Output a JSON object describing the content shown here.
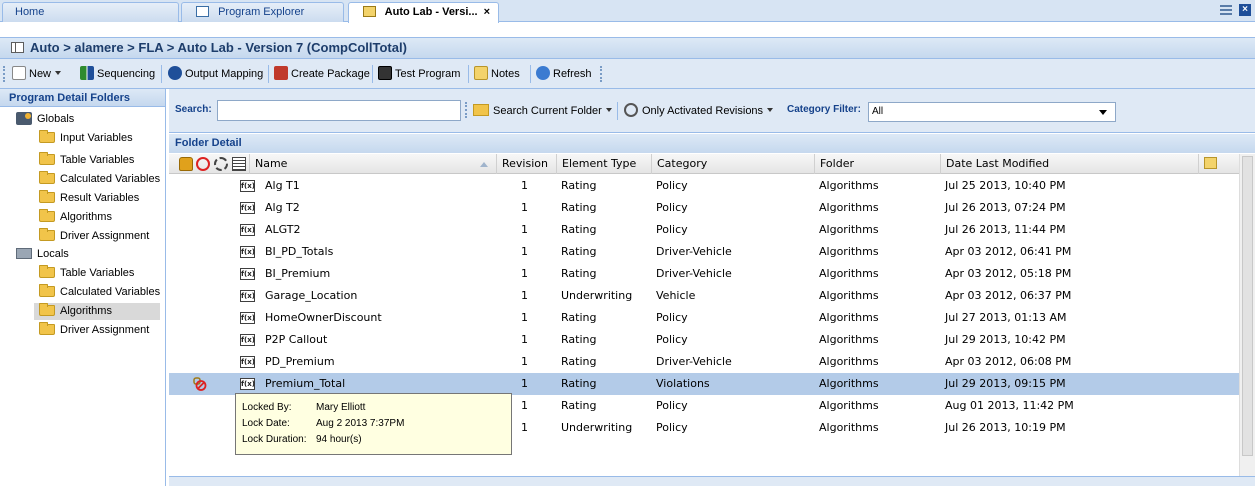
{
  "tabs": [
    {
      "label": "Home"
    },
    {
      "label": "Program Explorer"
    },
    {
      "label": "Auto Lab - Versi..."
    }
  ],
  "tab_close_glyph": "×",
  "breadcrumb": "Auto > alamere > FLA > Auto Lab - Version 7 (CompCollTotal)",
  "toolbar": {
    "new_label": "New",
    "sequencing_label": "Sequencing",
    "output_mapping_label": "Output Mapping",
    "create_package_label": "Create Package",
    "test_program_label": "Test Program",
    "notes_label": "Notes",
    "refresh_label": "Refresh"
  },
  "left_panel": {
    "title": "Program Detail Folders",
    "globals_label": "Globals",
    "globals_children": [
      "Input Variables",
      "Table Variables",
      "Calculated Variables",
      "Result Variables",
      "Algorithms",
      "Driver Assignment"
    ],
    "locals_label": "Locals",
    "locals_children": [
      "Table Variables",
      "Calculated Variables",
      "Algorithms",
      "Driver Assignment"
    ],
    "selected": "Locals/Algorithms"
  },
  "search": {
    "label": "Search:",
    "value": "",
    "search_current_folder_label": "Search Current Folder",
    "only_activated_label": "Only Activated Revisions",
    "category_filter_label": "Category Filter:",
    "category_filter_value": "All"
  },
  "folder_detail": {
    "title": "Folder Detail",
    "columns": {
      "name": "Name",
      "revision": "Revision",
      "element_type": "Element Type",
      "category": "Category",
      "folder": "Folder",
      "date": "Date Last Modified"
    },
    "rows": [
      {
        "name": "Alg T1",
        "revision": "1",
        "element_type": "Rating",
        "category": "Policy",
        "folder": "Algorithms",
        "date": "Jul 25 2013, 10:40 PM",
        "locked": false
      },
      {
        "name": "Alg T2",
        "revision": "1",
        "element_type": "Rating",
        "category": "Policy",
        "folder": "Algorithms",
        "date": "Jul 26 2013, 07:24 PM",
        "locked": false
      },
      {
        "name": "ALGT2",
        "revision": "1",
        "element_type": "Rating",
        "category": "Policy",
        "folder": "Algorithms",
        "date": "Jul 26 2013, 11:44 PM",
        "locked": false
      },
      {
        "name": "BI_PD_Totals",
        "revision": "1",
        "element_type": "Rating",
        "category": "Driver-Vehicle",
        "folder": "Algorithms",
        "date": "Apr 03 2012, 06:41 PM",
        "locked": false
      },
      {
        "name": "BI_Premium",
        "revision": "1",
        "element_type": "Rating",
        "category": "Driver-Vehicle",
        "folder": "Algorithms",
        "date": "Apr 03 2012, 05:18 PM",
        "locked": false
      },
      {
        "name": "Garage_Location",
        "revision": "1",
        "element_type": "Underwriting",
        "category": "Vehicle",
        "folder": "Algorithms",
        "date": "Apr 03 2012, 06:37 PM",
        "locked": false
      },
      {
        "name": "HomeOwnerDiscount",
        "revision": "1",
        "element_type": "Rating",
        "category": "Policy",
        "folder": "Algorithms",
        "date": "Jul 27 2013, 01:13 AM",
        "locked": false
      },
      {
        "name": "P2P Callout",
        "revision": "1",
        "element_type": "Rating",
        "category": "Policy",
        "folder": "Algorithms",
        "date": "Jul 29 2013, 10:42 PM",
        "locked": false
      },
      {
        "name": "PD_Premium",
        "revision": "1",
        "element_type": "Rating",
        "category": "Driver-Vehicle",
        "folder": "Algorithms",
        "date": "Apr 03 2012, 06:08 PM",
        "locked": false
      },
      {
        "name": "Premium_Total",
        "revision": "1",
        "element_type": "Rating",
        "category": "Violations",
        "folder": "Algorithms",
        "date": "Jul 29 2013, 09:15 PM",
        "locked": true
      },
      {
        "name": "",
        "revision": "1",
        "element_type": "Rating",
        "category": "Policy",
        "folder": "Algorithms",
        "date": "Aug 01 2013, 11:42 PM",
        "locked": false
      },
      {
        "name": "",
        "revision": "1",
        "element_type": "Underwriting",
        "category": "Policy",
        "folder": "Algorithms",
        "date": "Jul 26 2013, 10:19 PM",
        "locked": false
      }
    ],
    "selected_row": 9
  },
  "tooltip": {
    "locked_by_label": "Locked By:",
    "locked_by": "Mary Elliott",
    "lock_date_label": "Lock Date:",
    "lock_date": "Aug 2 2013 7:37PM",
    "lock_duration_label": "Lock Duration:",
    "lock_duration": "94 hour(s)"
  },
  "colors": {
    "accent": "#15428b",
    "selected_row": "#b3cbe8",
    "tooltip_bg": "#ffffe1"
  }
}
